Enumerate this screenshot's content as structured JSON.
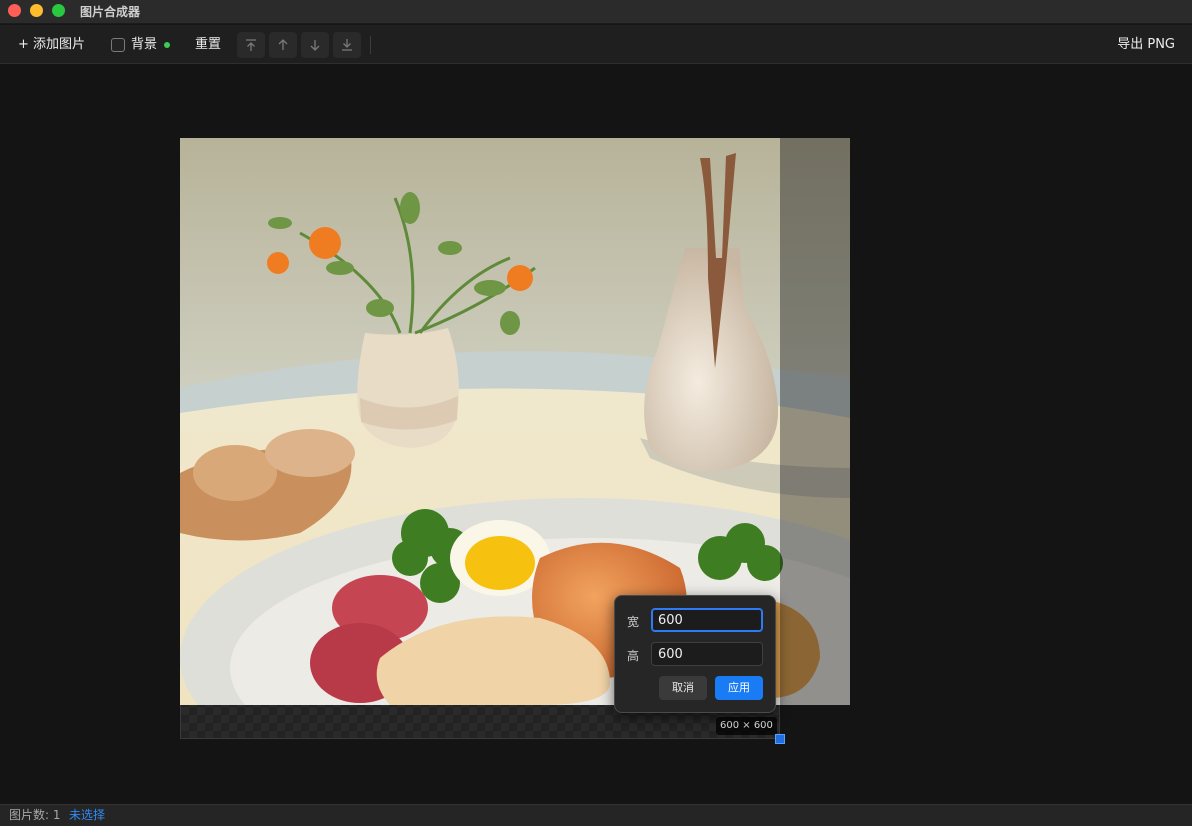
{
  "window": {
    "title": "图片合成器"
  },
  "toolbar": {
    "add_label": "+ 添加图片",
    "background_label": "背景",
    "reset_label": "重置",
    "order_buttons": [
      "bring-to-front-icon",
      "move-up-icon",
      "move-down-icon",
      "send-to-back-icon"
    ],
    "export_label": "导出 PNG"
  },
  "canvas": {
    "size_label": "600 × 600"
  },
  "resize_popover": {
    "width_label": "宽",
    "width_value": "600",
    "height_label": "高",
    "height_value": "600",
    "cancel_label": "取消",
    "apply_label": "应用"
  },
  "status": {
    "count_text": "图片数: 1",
    "selection_text": "未选择"
  },
  "colors": {
    "accent": "#1a7cf5",
    "status_dot": "#3ecb55"
  }
}
